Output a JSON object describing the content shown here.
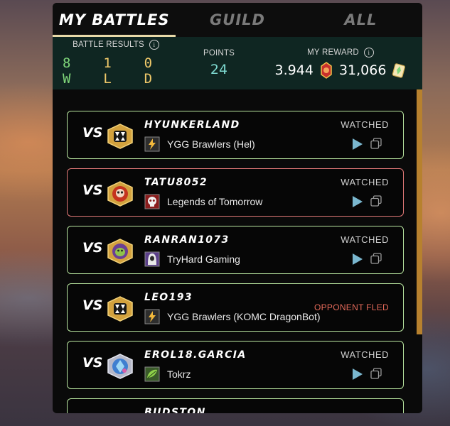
{
  "tabs": [
    {
      "label": "MY BATTLES",
      "active": true
    },
    {
      "label": "GUILD",
      "active": false
    },
    {
      "label": "ALL",
      "active": false
    }
  ],
  "summary": {
    "battle_results_label": "BATTLE RESULTS",
    "wins": "8 W",
    "losses": "1 L",
    "draws": "0 D",
    "points_label": "POINTS",
    "points_value": "24",
    "reward_label": "MY REWARD",
    "reward_primary": "3.944",
    "reward_secondary": "31,066"
  },
  "colors": {
    "win_border": "#b9e6a0",
    "loss_border": "#e47a78",
    "fled_text": "#e56a5a",
    "scrollbar": "#b7812e"
  },
  "vs_label": "VS",
  "battles": [
    {
      "opponent": "HYUNKERLAND",
      "guild": "YGG Brawlers (Hel)",
      "status": "WATCHED",
      "result": "win",
      "avatar": "fanged-shield-icon",
      "guild_icon": "lightning-banner-icon"
    },
    {
      "opponent": "TATU8052",
      "guild": "Legends of Tomorrow",
      "status": "WATCHED",
      "result": "loss",
      "avatar": "fire-skull-avatar-icon",
      "guild_icon": "red-skull-banner-icon"
    },
    {
      "opponent": "RANRAN1073",
      "guild": "TryHard Gaming",
      "status": "WATCHED",
      "result": "win",
      "avatar": "green-creature-avatar-icon",
      "guild_icon": "hooded-figure-banner-icon"
    },
    {
      "opponent": "LEO193",
      "guild": "YGG Brawlers (KOMC DragonBot)",
      "status": "OPPONENT FLED",
      "result": "win",
      "avatar": "fanged-shield-icon",
      "guild_icon": "lightning-banner-icon"
    },
    {
      "opponent": "EROL18.GARCIA",
      "guild": "Tokrz",
      "status": "WATCHED",
      "result": "win",
      "avatar": "blue-crystal-avatar-icon",
      "guild_icon": "green-leaf-banner-icon"
    },
    {
      "opponent": "BUDSTON",
      "guild": "",
      "status": "",
      "result": "win",
      "avatar": "",
      "guild_icon": ""
    }
  ]
}
